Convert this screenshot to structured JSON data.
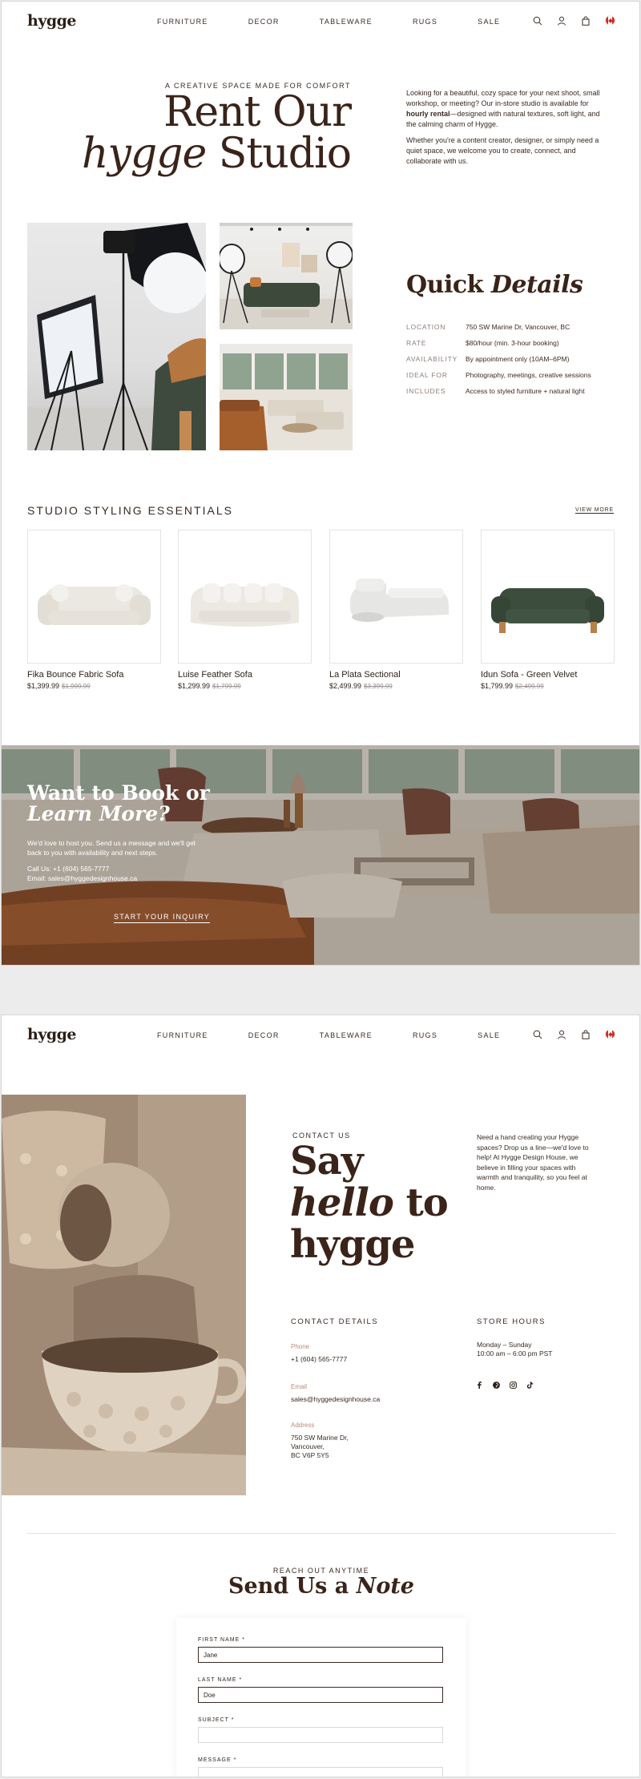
{
  "brand": {
    "logo": "hygge"
  },
  "nav": [
    "FURNITURE",
    "DECOR",
    "TABLEWARE",
    "RUGS",
    "SALE"
  ],
  "hero": {
    "eyebrow": "A CREATIVE SPACE MADE FOR COMFORT",
    "title_line1": "Rent Our",
    "title_em": "hygge",
    "title_rest": " Studio",
    "p1_before": "Looking for a beautiful, cozy space for your next shoot, small workshop, or meeting? Our in-store studio is available for ",
    "p1_bold": "hourly rental",
    "p1_after": "—designed with natural textures, soft light, and the calming charm of Hygge.",
    "p2": "Whether you're a content creator, designer, or simply need a quiet space, we welcome you to create, connect, and collaborate with us."
  },
  "quick_details": {
    "title_plain": "Quick ",
    "title_em": "Details",
    "rows": [
      {
        "label": "LOCATION",
        "value": "750 SW Marine Dr, Vancouver, BC"
      },
      {
        "label": "RATE",
        "value": "$80/hour (min. 3-hour booking)"
      },
      {
        "label": "AVAILABILITY",
        "value": "By appointment only (10AM–6PM)"
      },
      {
        "label": "IDEAL FOR",
        "value": "Photography, meetings, creative sessions"
      },
      {
        "label": "INCLUDES",
        "value": "Access to styled furniture + natural light"
      }
    ]
  },
  "essentials": {
    "title": "STUDIO STYLING ESSENTIALS",
    "view_more": "VIEW MORE",
    "products": [
      {
        "name": "Fika Bounce Fabric Sofa",
        "price": "$1,399.99",
        "old_price": "$1,999.99"
      },
      {
        "name": "Luise Feather Sofa",
        "price": "$1,299.99",
        "old_price": "$1,799.99"
      },
      {
        "name": "La Plata Sectional",
        "price": "$2,499.99",
        "old_price": "$3,399.99"
      },
      {
        "name": "Idun Sofa - Green Velvet",
        "price": "$1,799.99",
        "old_price": "$2,499.99"
      }
    ]
  },
  "banner": {
    "title_line1": "Want to Book or",
    "title_em": "Learn More?",
    "text": "We'd love to host you. Send us a message and we'll get back to you with availability and next steps.",
    "call": "Call Us: +1 (604) 565-7777",
    "email": "Email: sales@hyggedesignhouse.ca",
    "button": "START YOUR INQUIRY"
  },
  "contact": {
    "eyebrow": "CONTACT US",
    "title_line1": "Say",
    "title_em": "hello",
    "title_after_em": " to",
    "title_line3": "hygge",
    "text": "Need a hand creating your Hygge spaces? Drop us a line—we'd love to help! At Hygge Design House, we believe in filling your spaces with warmth and tranquility, so you feel at home.",
    "details_head": "CONTACT DETAILS",
    "phone_label": "Phone",
    "phone": "+1 (604) 565-7777",
    "email_label": "Email",
    "email": "sales@hyggedesignhouse.ca",
    "address_label": "Address",
    "address_line1": "750 SW Marine Dr,",
    "address_line2": "Vancouver,",
    "address_line3": "BC V6P 5Y5",
    "hours_head": "STORE HOURS",
    "hours_days": "Monday – Sunday",
    "hours_time": "10:00 am – 6:00 pm PST"
  },
  "form": {
    "eyebrow": "REACH OUT ANYTIME",
    "title_plain": "Send Us a ",
    "title_em": "Note",
    "first_name_label": "FIRST NAME *",
    "first_name_value": "Jane",
    "last_name_label": "LAST NAME *",
    "last_name_value": "Doe",
    "subject_label": "SUBJECT *",
    "subject_value": "",
    "message_label": "MESSAGE *"
  },
  "colors": {
    "brand_dark": "#3a2319",
    "accent_label": "#b88d7a",
    "flag_red": "#d52b1e"
  },
  "icons": [
    "search-icon",
    "account-icon",
    "bag-icon",
    "canada-flag-icon",
    "facebook-icon",
    "pinterest-icon",
    "instagram-icon",
    "tiktok-icon"
  ]
}
